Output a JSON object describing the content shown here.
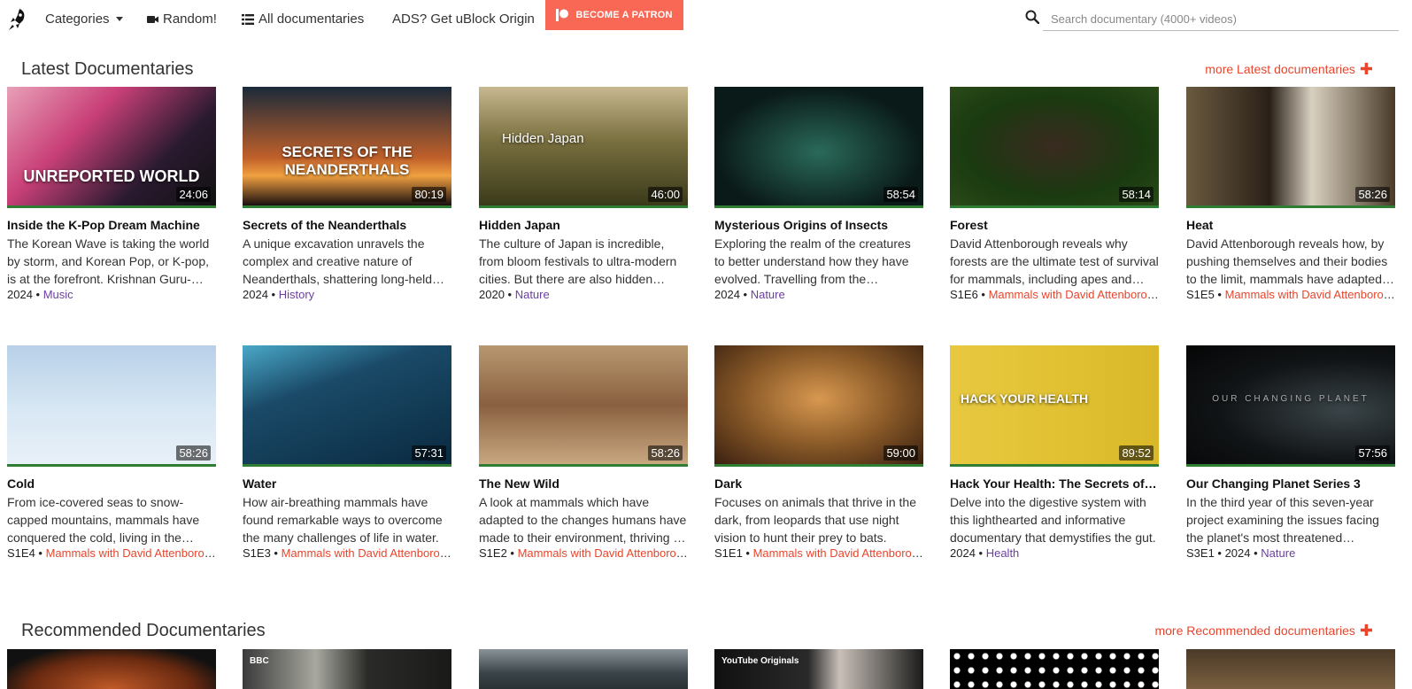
{
  "nav": {
    "categories": "Categories",
    "random": "Random!",
    "all": "All documentaries",
    "ads_strong": "ADS?",
    "ads_rest": " Get uBlock Origin",
    "patron": "BECOME A PATRON",
    "search_placeholder": "Search documentary (4000+ videos)"
  },
  "latest": {
    "title": "Latest Documentaries",
    "more": "more Latest documentaries",
    "cards": [
      {
        "title": "Inside the K-Pop Dream Machine",
        "desc": "The Korean Wave is taking the world by storm, and Korean Pop, or K-pop, is at the forefront. Krishnan Guru-Murthy goes behind the scenes.",
        "duration": "24:06",
        "meta_pre": "2024",
        "category": "Music",
        "cat_color": "purple",
        "overlay": "UNREPORTED WORLD"
      },
      {
        "title": "Secrets of the Neanderthals",
        "desc": "A unique excavation unravels the complex and creative nature of Neanderthals, shattering long-held myths.",
        "duration": "80:19",
        "meta_pre": "2024",
        "category": "History",
        "cat_color": "purple",
        "overlay": "SECRETS OF THE NEANDERTHALS"
      },
      {
        "title": "Hidden Japan",
        "desc": "The culture of Japan is incredible, from bloom festivals to ultra-modern cities. But there are also hidden places.",
        "duration": "46:00",
        "meta_pre": "2020",
        "category": "Nature",
        "cat_color": "purple",
        "overlay": "Hidden Japan"
      },
      {
        "title": "Mysterious Origins of Insects",
        "desc": "Exploring the realm of the creatures to better understand how they have evolved. Travelling from the rainforests.",
        "duration": "58:54",
        "meta_pre": "2024",
        "category": "Nature",
        "cat_color": "purple",
        "overlay": ""
      },
      {
        "title": "Forest",
        "desc": "David Attenborough reveals why forests are the ultimate test of survival for mammals, including apes and monkeys.",
        "duration": "58:14",
        "meta_pre": "S1E6",
        "category": "Mammals with David Attenborough",
        "cat_color": "orange",
        "overlay": ""
      },
      {
        "title": "Heat",
        "desc": "David Attenborough reveals how, by pushing themselves and their bodies to the limit, mammals have adapted to heat.",
        "duration": "58:26",
        "meta_pre": "S1E5",
        "category": "Mammals with David Attenborough",
        "cat_color": "orange",
        "overlay": ""
      },
      {
        "title": "Cold",
        "desc": "From ice-covered seas to snow-capped mountains, mammals have conquered the cold, living in the harshest places.",
        "duration": "58:26",
        "meta_pre": "S1E4",
        "category": "Mammals with David Attenborough",
        "cat_color": "orange",
        "overlay": ""
      },
      {
        "title": "Water",
        "desc": "How air-breathing mammals have found remarkable ways to overcome the many challenges of life in water.",
        "duration": "57:31",
        "meta_pre": "S1E3",
        "category": "Mammals with David Attenborough",
        "cat_color": "orange",
        "overlay": ""
      },
      {
        "title": "The New Wild",
        "desc": "A look at mammals which have adapted to the changes humans have made to their environment, thriving in cities.",
        "duration": "58:26",
        "meta_pre": "S1E2",
        "category": "Mammals with David Attenborough",
        "cat_color": "orange",
        "overlay": ""
      },
      {
        "title": "Dark",
        "desc": "Focuses on animals that thrive in the dark, from leopards that use night vision to hunt their prey to bats.",
        "duration": "59:00",
        "meta_pre": "S1E1",
        "category": "Mammals with David Attenborough",
        "cat_color": "orange",
        "overlay": ""
      },
      {
        "title": "Hack Your Health: The Secrets of Your Gut",
        "desc": "Delve into the digestive system with this lighthearted and informative documentary that demystifies the gut.",
        "duration": "89:52",
        "meta_pre": "2024",
        "category": "Health",
        "cat_color": "purple",
        "overlay": "HACK YOUR HEALTH"
      },
      {
        "title": "Our Changing Planet Series 3",
        "desc": "In the third year of this seven-year project examining the issues facing the planet's most threatened ecosystems.",
        "duration": "57:56",
        "meta_pre": "S3E1 • 2024",
        "category": "Nature",
        "cat_color": "purple",
        "overlay": "OUR CHANGING PLANET"
      }
    ]
  },
  "recommended": {
    "title": "Recommended Documentaries",
    "more": "more Recommended documentaries",
    "thumb_labels": [
      "",
      "BBC",
      "",
      "YouTube Originals",
      "",
      ""
    ]
  },
  "colors": {
    "accent": "#e8452c",
    "patron": "#f96854",
    "purple": "#6a3fa0",
    "green": "#2e7d32"
  }
}
